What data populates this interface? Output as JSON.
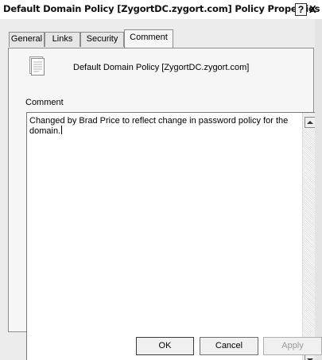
{
  "window": {
    "title": "Default Domain Policy [ZygortDC.zygort.com] Policy Properties",
    "help_label": "?",
    "close_label": "X"
  },
  "tabs": [
    {
      "label": "General",
      "active": false
    },
    {
      "label": "Links",
      "active": false
    },
    {
      "label": "Security",
      "active": false
    },
    {
      "label": "Comment",
      "active": true
    }
  ],
  "panel": {
    "icon": "document-icon",
    "policy_name": "Default Domain Policy [ZygortDC.zygort.com]",
    "comment_label": "Comment",
    "comment_text": "Changed by Brad Price to reflect change in password policy for the domain."
  },
  "buttons": {
    "ok": "OK",
    "cancel": "Cancel",
    "apply": "Apply"
  }
}
